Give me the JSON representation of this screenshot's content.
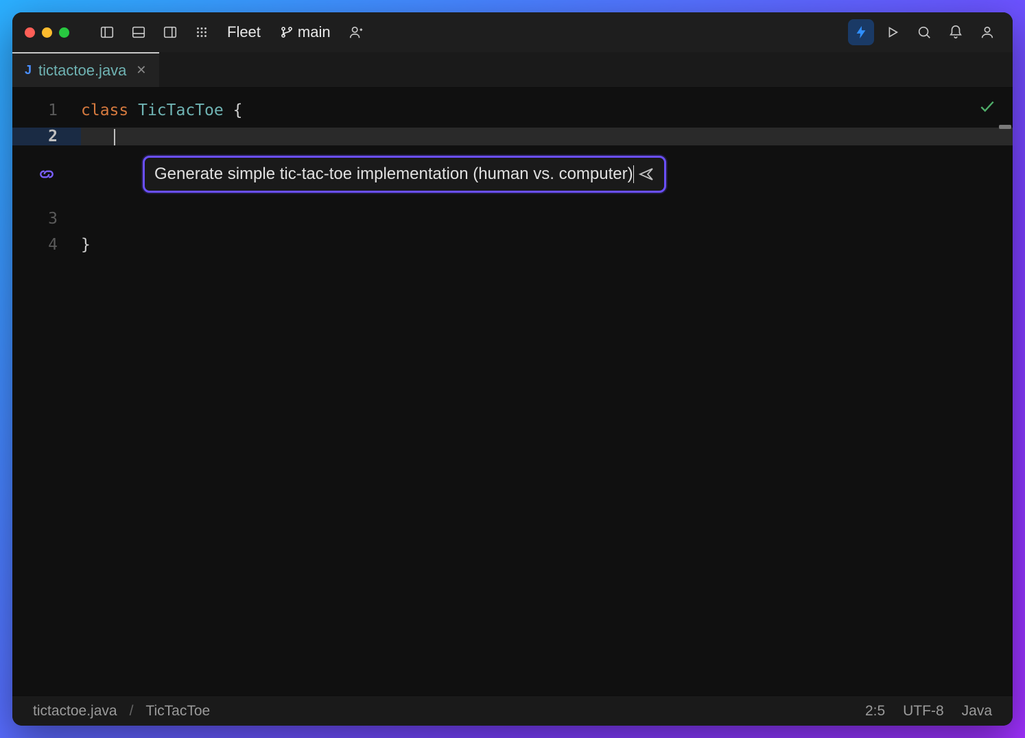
{
  "titlebar": {
    "app_label": "Fleet",
    "branch_label": "main"
  },
  "tab": {
    "filename": "tictactoe.java"
  },
  "editor": {
    "lines": {
      "l1_num": "1",
      "l1_kw": "class",
      "l1_cls": "TicTacToe",
      "l1_tail": " {",
      "l2_num": "2",
      "l3_num": "3",
      "l4_num": "4",
      "l4_text": "}"
    }
  },
  "ai_prompt": {
    "text": "Generate simple tic-tac-toe implementation (human vs. computer)"
  },
  "status": {
    "file": "tictactoe.java",
    "symbol": "TicTacToe",
    "cursor": "2:5",
    "encoding": "UTF-8",
    "language": "Java"
  }
}
